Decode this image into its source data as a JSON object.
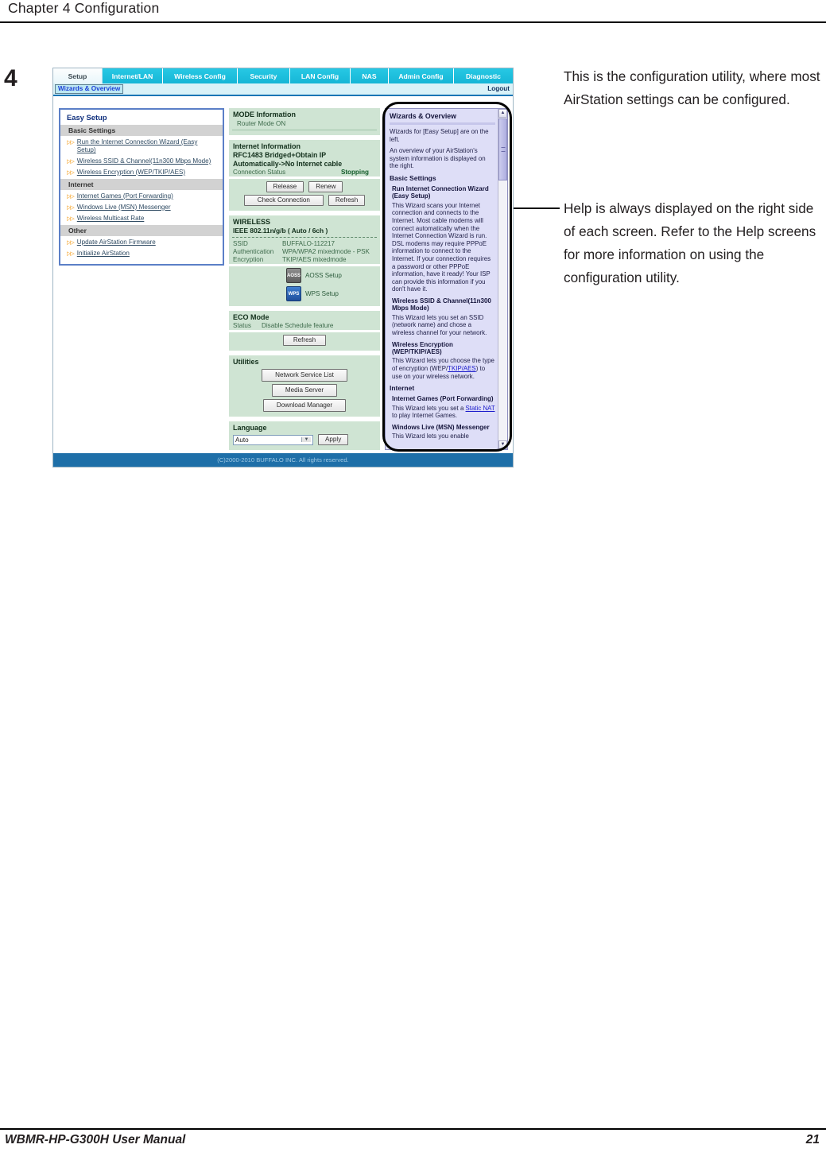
{
  "page": {
    "chapter": "Chapter 4  Configuration",
    "step_number": "4",
    "footer_left": "WBMR-HP-G300H User Manual",
    "footer_page": "21"
  },
  "annotations": {
    "first": "This is the configuration utility, where most AirStation settings can be configured.",
    "second": "Help is always displayed on the right side of each screen. Refer to the Help screens for more information on using the configuration utility."
  },
  "router_ui": {
    "tabs": [
      {
        "label": "Setup",
        "active": true
      },
      {
        "label": "Internet/LAN",
        "active": false
      },
      {
        "label": "Wireless Config",
        "active": false
      },
      {
        "label": "Security",
        "active": false
      },
      {
        "label": "LAN Config",
        "active": false
      },
      {
        "label": "NAS",
        "active": false
      },
      {
        "label": "Admin Config",
        "active": false
      },
      {
        "label": "Diagnostic",
        "active": false
      }
    ],
    "breadcrumb": "Wizards & Overview",
    "logout": "Logout",
    "sidebar": {
      "title": "Easy Setup",
      "groups": [
        {
          "header": "Basic Settings",
          "links": [
            "Run the Internet Connection Wizard (Easy Setup)",
            "Wireless SSID & Channel(11n300 Mbps Mode)",
            "Wireless Encryption (WEP/TKIP/AES)"
          ]
        },
        {
          "header": "Internet",
          "links": [
            "Internet Games (Port Forwarding)",
            "Windows Live (MSN) Messenger",
            "Wireless Multicast Rate"
          ]
        },
        {
          "header": "Other",
          "links": [
            "Update AirStation Firmware",
            "Initialize AirStation"
          ]
        }
      ]
    },
    "mode_information": {
      "header": "MODE Information",
      "value": "Router Mode ON"
    },
    "internet_information": {
      "header": "Internet Information",
      "summary_line1": "RFC1483 Bridged+Obtain IP",
      "summary_line2": "Automatically->No Internet cable",
      "status_label": "Connection Status",
      "status_value": "Stopping",
      "buttons": {
        "release": "Release",
        "renew": "Renew",
        "check_connection": "Check Connection",
        "refresh": "Refresh"
      }
    },
    "wireless": {
      "header": "WIRELESS",
      "standard": "IEEE 802.11n/g/b ( Auto / 6ch )",
      "ssid_label": "SSID",
      "ssid_value": "BUFFALO-112217",
      "auth_label": "Authentication",
      "auth_value": "WPA/WPA2 mixedmode - PSK",
      "encryption_label": "Encryption",
      "encryption_value": "TKIP/AES mixedmode",
      "aoss_label": "AOSS Setup",
      "aoss_icon_text": "AOSS",
      "wps_label": "WPS Setup",
      "wps_icon_text": "WPS"
    },
    "eco_mode": {
      "header": "ECO Mode",
      "status_label": "Status",
      "status_value": "Disable Schedule feature",
      "refresh_button": "Refresh"
    },
    "utilities": {
      "header": "Utilities",
      "buttons": [
        "Network Service List",
        "Media Server",
        "Download Manager"
      ]
    },
    "language": {
      "header": "Language",
      "selected": "Auto",
      "apply_button": "Apply"
    },
    "help": {
      "title": "Wizards & Overview",
      "paragraph1": "Wizards for [Easy Setup] are on the left.",
      "paragraph2": "An overview of your AirStation's system information is displayed on the right.",
      "section_basic": "Basic Settings",
      "item1_title": "Run Internet Connection Wizard (Easy Setup)",
      "item1_body": "This Wizard scans your Internet connection and connects to the Internet. Most cable modems will connect automatically when the Internet Connection Wizard is run. DSL modems may require PPPoE information to connect to the Internet. If your connection requires a password or other PPPoE information, have it ready! Your ISP can provide this information if you don't have it.",
      "item2_title": "Wireless SSID & Channel(11n300 Mbps Mode)",
      "item2_body": "This Wizard lets you set an SSID (network name) and chose a wireless channel for your network.",
      "item3_title": "Wireless Encryption (WEP/TKIP/AES)",
      "item3_body_pre": "This Wizard lets you choose the type of encryption (WEP/",
      "item3_link": "TKIP/AES",
      "item3_body_post": ") to use on your wireless network.",
      "section_internet": "Internet",
      "item4_title": "Internet Games (Port Forwarding)",
      "item4_body_pre": "This Wizard lets you set a ",
      "item4_link": "Static NAT",
      "item4_body_post": " to play Internet Games.",
      "item5_title": "Windows Live (MSN) Messenger",
      "item5_body": "This Wizard lets you enable"
    },
    "copyright": "(C)2000-2010 BUFFALO INC. All rights reserved."
  }
}
